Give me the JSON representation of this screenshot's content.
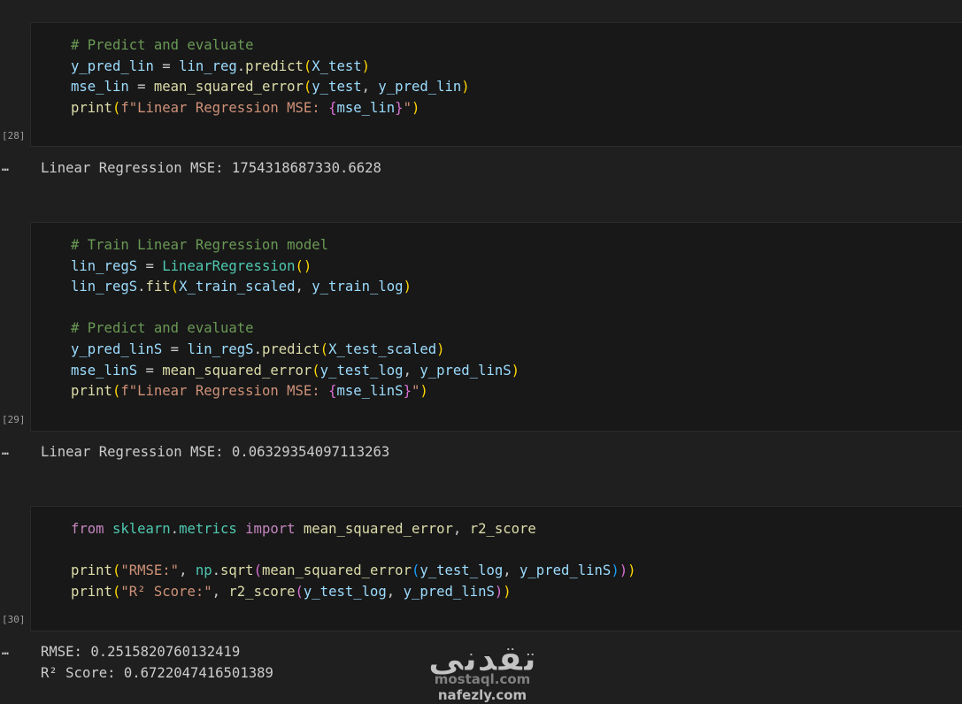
{
  "cells": [
    {
      "execution_count": "[28]",
      "lines": [
        [
          [
            "# Predict and evaluate",
            "cm"
          ]
        ],
        [
          [
            "y_pred_lin",
            "vr"
          ],
          [
            " = ",
            "pl"
          ],
          [
            "lin_reg",
            "vr"
          ],
          [
            ".",
            "pl"
          ],
          [
            "predict",
            "fn"
          ],
          [
            "(",
            "b1"
          ],
          [
            "X_test",
            "vr"
          ],
          [
            ")",
            "b1"
          ]
        ],
        [
          [
            "mse_lin",
            "vr"
          ],
          [
            " = ",
            "pl"
          ],
          [
            "mean_squared_error",
            "fn"
          ],
          [
            "(",
            "b1"
          ],
          [
            "y_test",
            "vr"
          ],
          [
            ", ",
            "pl"
          ],
          [
            "y_pred_lin",
            "vr"
          ],
          [
            ")",
            "b1"
          ]
        ],
        [
          [
            "print",
            "fn"
          ],
          [
            "(",
            "b1"
          ],
          [
            "f\"Linear Regression MSE: ",
            "st"
          ],
          [
            "{",
            "b2"
          ],
          [
            "mse_lin",
            "vr"
          ],
          [
            "}",
            "b2"
          ],
          [
            "\"",
            "st"
          ],
          [
            ")",
            "b1"
          ]
        ]
      ],
      "output": [
        "Linear Regression MSE: 1754318687330.6628"
      ]
    },
    {
      "execution_count": "[29]",
      "lines": [
        [
          [
            "# Train Linear Regression model",
            "cm"
          ]
        ],
        [
          [
            "lin_regS",
            "vr"
          ],
          [
            " = ",
            "pl"
          ],
          [
            "LinearRegression",
            "cl"
          ],
          [
            "()",
            "b1"
          ]
        ],
        [
          [
            "lin_regS",
            "vr"
          ],
          [
            ".",
            "pl"
          ],
          [
            "fit",
            "fn"
          ],
          [
            "(",
            "b1"
          ],
          [
            "X_train_scaled",
            "vr"
          ],
          [
            ", ",
            "pl"
          ],
          [
            "y_train_log",
            "vr"
          ],
          [
            ")",
            "b1"
          ]
        ],
        [],
        [
          [
            "# Predict and evaluate",
            "cm"
          ]
        ],
        [
          [
            "y_pred_linS",
            "vr"
          ],
          [
            " = ",
            "pl"
          ],
          [
            "lin_regS",
            "vr"
          ],
          [
            ".",
            "pl"
          ],
          [
            "predict",
            "fn"
          ],
          [
            "(",
            "b1"
          ],
          [
            "X_test_scaled",
            "vr"
          ],
          [
            ")",
            "b1"
          ]
        ],
        [
          [
            "mse_linS",
            "vr"
          ],
          [
            " = ",
            "pl"
          ],
          [
            "mean_squared_error",
            "fn"
          ],
          [
            "(",
            "b1"
          ],
          [
            "y_test_log",
            "vr"
          ],
          [
            ", ",
            "pl"
          ],
          [
            "y_pred_linS",
            "vr"
          ],
          [
            ")",
            "b1"
          ]
        ],
        [
          [
            "print",
            "fn"
          ],
          [
            "(",
            "b1"
          ],
          [
            "f\"Linear Regression MSE: ",
            "st"
          ],
          [
            "{",
            "b2"
          ],
          [
            "mse_linS",
            "vr"
          ],
          [
            "}",
            "b2"
          ],
          [
            "\"",
            "st"
          ],
          [
            ")",
            "b1"
          ]
        ]
      ],
      "output": [
        "Linear Regression MSE: 0.06329354097113263"
      ]
    },
    {
      "execution_count": "[30]",
      "lines": [
        [
          [
            "from",
            "kw"
          ],
          [
            " ",
            "pl"
          ],
          [
            "sklearn",
            "cl"
          ],
          [
            ".",
            "pl"
          ],
          [
            "metrics",
            "cl"
          ],
          [
            " ",
            "pl"
          ],
          [
            "import",
            "kw"
          ],
          [
            " ",
            "pl"
          ],
          [
            "mean_squared_error",
            "fn"
          ],
          [
            ", ",
            "pl"
          ],
          [
            "r2_score",
            "fn"
          ]
        ],
        [],
        [
          [
            "print",
            "fn"
          ],
          [
            "(",
            "b1"
          ],
          [
            "\"RMSE:\"",
            "st"
          ],
          [
            ", ",
            "pl"
          ],
          [
            "np",
            "cl"
          ],
          [
            ".",
            "pl"
          ],
          [
            "sqrt",
            "fn"
          ],
          [
            "(",
            "b2"
          ],
          [
            "mean_squared_error",
            "fn"
          ],
          [
            "(",
            "b3"
          ],
          [
            "y_test_log",
            "vr"
          ],
          [
            ", ",
            "pl"
          ],
          [
            "y_pred_linS",
            "vr"
          ],
          [
            ")",
            "b3"
          ],
          [
            ")",
            "b2"
          ],
          [
            ")",
            "b1"
          ]
        ],
        [
          [
            "print",
            "fn"
          ],
          [
            "(",
            "b1"
          ],
          [
            "\"R² Score:\"",
            "st"
          ],
          [
            ", ",
            "pl"
          ],
          [
            "r2_score",
            "fn"
          ],
          [
            "(",
            "b2"
          ],
          [
            "y_test_log",
            "vr"
          ],
          [
            ", ",
            "pl"
          ],
          [
            "y_pred_linS",
            "vr"
          ],
          [
            ")",
            "b2"
          ],
          [
            ")",
            "b1"
          ]
        ]
      ],
      "output": [
        "RMSE: 0.2515820760132419",
        "R² Score: 0.6722047416501389"
      ]
    }
  ],
  "watermark": {
    "logo_text": "تقدني",
    "line1": "mostaql.com",
    "line2": "nafezly.com"
  }
}
